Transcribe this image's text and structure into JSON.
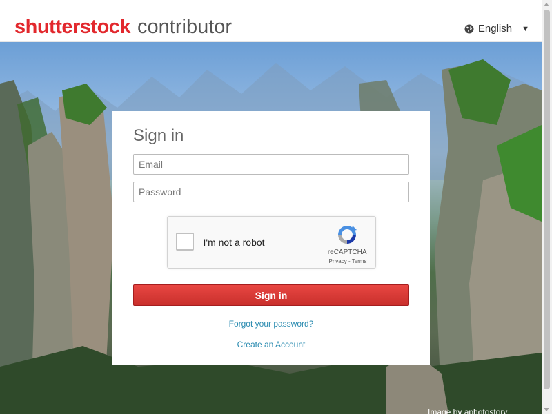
{
  "header": {
    "logo_brand": "shutterstock",
    "logo_sub": "contributor",
    "language": "English",
    "language_icon": "globe-icon",
    "caret": "▼"
  },
  "signin": {
    "title": "Sign in",
    "email_placeholder": "Email",
    "password_placeholder": "Password",
    "button_label": "Sign in",
    "forgot_link": "Forgot your password?",
    "create_link": "Create an Account"
  },
  "recaptcha": {
    "label": "I'm not a robot",
    "brand": "reCAPTCHA",
    "terms": "Privacy - Terms"
  },
  "footer": {
    "image_credit": "Image by aphotostory"
  },
  "colors": {
    "brand_red": "#e2282d",
    "button_red": "#c9302c",
    "link_blue": "#2a8bb0"
  }
}
